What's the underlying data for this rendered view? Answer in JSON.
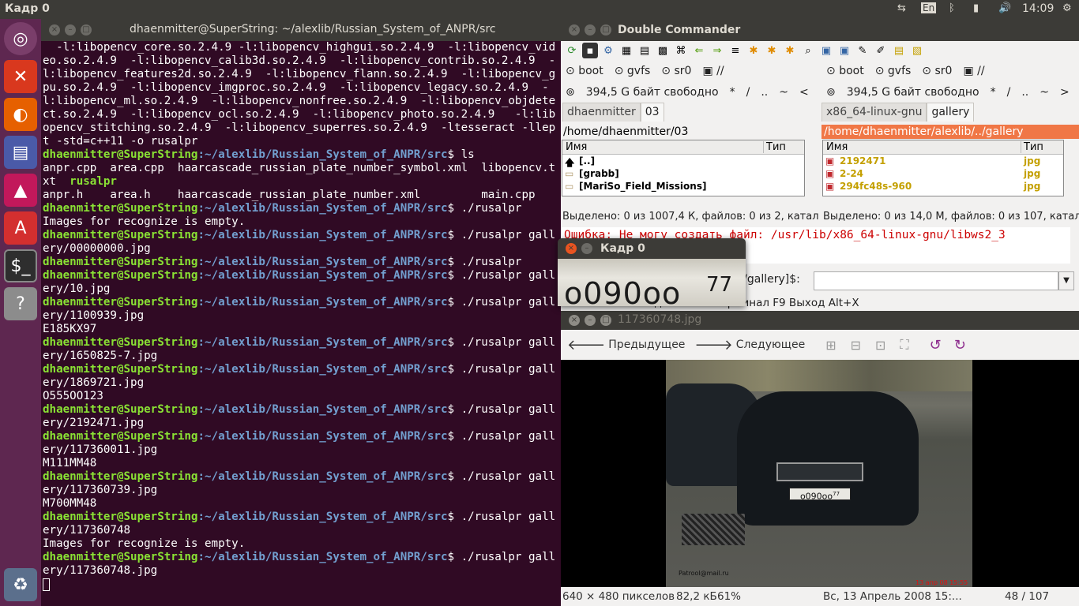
{
  "topbar": {
    "title": "Кадр 0",
    "lang": "En",
    "clock": "14:09"
  },
  "launcher": {
    "items": [
      "ubuntu-icon",
      "files-icon",
      "firefox-icon",
      "text-editor-icon",
      "image-viewer-icon",
      "software-icon",
      "terminal-icon",
      "help-icon",
      "trash-icon"
    ]
  },
  "terminal": {
    "title": "dhaenmitter@SuperString: ~/alexlib/Russian_System_of_ANPR/src",
    "prompt_user": "dhaenmitter@SuperString",
    "prompt_path": ":~/alexlib/Russian_System_of_ANPR/src",
    "lines": [
      {
        "t": "text",
        "s": "  -l:libopencv_core.so.2.4.9 -l:libopencv_highgui.so.2.4.9  -l:libopencv_video.so.2.4.9  -l:libopencv_calib3d.so.2.4.9  -l:libopencv_contrib.so.2.4.9  -l:libopencv_features2d.so.2.4.9  -l:libopencv_flann.so.2.4.9  -l:libopencv_gpu.so.2.4.9  -l:libopencv_imgproc.so.2.4.9  -l:libopencv_legacy.so.2.4.9  -l:libopencv_ml.so.2.4.9  -l:libopencv_nonfree.so.2.4.9  -l:libopencv_objdetect.so.2.4.9  -l:libopencv_ocl.so.2.4.9  -l:libopencv_photo.so.2.4.9   -l:libopencv_stitching.so.2.4.9  -l:libopencv_superres.so.2.4.9  -ltesseract -llept -std=c++11 -o rusalpr"
      },
      {
        "t": "prompt",
        "s": "$ ls"
      },
      {
        "t": "text",
        "s": "anpr.cpp  area.cpp  haarcascade_russian_plate_number_symbol.xml  libopencv.txt  "
      },
      {
        "t": "text",
        "s": "anpr.h    area.h    haarcascade_russian_plate_number.xml         main.cpp"
      },
      {
        "t": "prompt",
        "s": "$ ./rusalpr"
      },
      {
        "t": "text",
        "s": "Images for recognize is empty."
      },
      {
        "t": "prompt",
        "s": "$ ./rusalpr gallery/00000000.jpg"
      },
      {
        "t": "prompt",
        "s": "$ ./rusalpr"
      },
      {
        "t": "prompt",
        "s": "$ ./rusalpr gallery/10.jpg"
      },
      {
        "t": "prompt",
        "s": "$ ./rusalpr gallery/1100939.jpg"
      },
      {
        "t": "text",
        "s": "E185KX97"
      },
      {
        "t": "prompt",
        "s": "$ ./rusalpr gallery/1650825-7.jpg"
      },
      {
        "t": "prompt",
        "s": "$ ./rusalpr gallery/1869721.jpg"
      },
      {
        "t": "text",
        "s": "O555OO123"
      },
      {
        "t": "prompt",
        "s": "$ ./rusalpr gallery/2192471.jpg"
      },
      {
        "t": "prompt",
        "s": "$ ./rusalpr gallery/117360011.jpg"
      },
      {
        "t": "text",
        "s": "M111MM48"
      },
      {
        "t": "prompt",
        "s": "$ ./rusalpr gallery/117360739.jpg"
      },
      {
        "t": "text",
        "s": "M700MM48"
      },
      {
        "t": "prompt",
        "s": "$ ./rusalpr gallery/117360748"
      },
      {
        "t": "text",
        "s": "Images for recognize is empty."
      },
      {
        "t": "prompt",
        "s": "$ ./rusalpr gallery/117360748.jpg"
      }
    ],
    "exec_name": "rusalpr"
  },
  "dc": {
    "title": "Double Commander",
    "left": {
      "drives": [
        "boot",
        "gvfs",
        "sr0",
        "//"
      ],
      "free": "394,5 G байт свободно",
      "nav": [
        "*",
        "/",
        "..",
        "~",
        "<"
      ],
      "tabs": [
        "dhaenmitter",
        "03"
      ],
      "path": "/home/dhaenmitter/03",
      "col_name": "Имя",
      "col_type": "Тип",
      "rows": [
        {
          "name": "[..]",
          "type": ""
        },
        {
          "name": "[grabb]",
          "type": ""
        },
        {
          "name": "[MariSo_Field_Missions]",
          "type": ""
        }
      ],
      "status": "Выделено: 0 из 1007,4 К, файлов: 0 из 2, катало"
    },
    "right": {
      "drives": [
        "boot",
        "gvfs",
        "sr0",
        "//"
      ],
      "free": "394,5 G байт свободно",
      "nav": [
        "*",
        "/",
        "..",
        "~",
        ">"
      ],
      "tabs": [
        "x86_64-linux-gnu",
        "gallery"
      ],
      "path": "/home/dhaenmitter/alexlib/../gallery",
      "col_name": "Имя",
      "col_type": "Тип",
      "rows": [
        {
          "name": "2192471",
          "type": "jpg"
        },
        {
          "name": "2-24",
          "type": "jpg"
        },
        {
          "name": "294fc48s-960",
          "type": "jpg"
        }
      ],
      "status": "Выделено: 0 из 14,0 M, файлов: 0 из 107, катало"
    },
    "error": "Ошибка: Не могу создать файл: /usr/lib/x86_64-linux-gnu/libws2_3",
    "cmd_prompt": "rc/gallery]$:",
    "fkeys": "F5 Переместить F6 Каталог F7 Удалить F8 Терминал F9 Выход Alt+X"
  },
  "viewer": {
    "title": "117360748.jpg",
    "prev": "Предыдущее",
    "next": "Следующее",
    "dims": "640 × 480 пикселов",
    "size": "82,2 кБ",
    "zoom": "61%",
    "date": "Вс, 13 Апрель 2008 15:...",
    "index": "48 / 107",
    "watermark": "Patrool@mail.ru",
    "stamp": "13 апр 08 15:55",
    "plate_text": "о090оо",
    "plate_region": "77"
  },
  "popup": {
    "title": "Кадр 0",
    "plate_text": "о090оо",
    "plate_region": "77"
  }
}
